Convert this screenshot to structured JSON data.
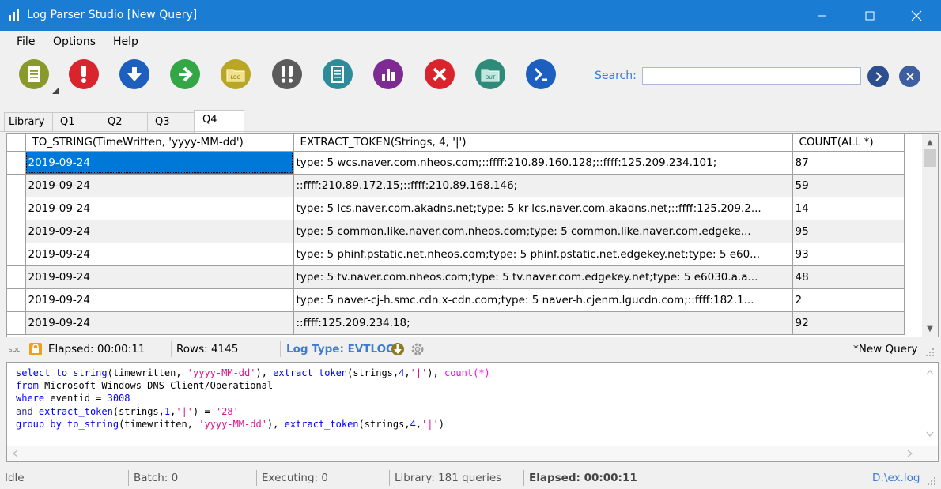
{
  "window": {
    "title": "Log Parser Studio  [New Query]"
  },
  "menu": [
    "File",
    "Options",
    "Help"
  ],
  "toolbar": {
    "buttons": [
      {
        "name": "new-query-icon",
        "color": "#8a9a2a"
      },
      {
        "name": "alert-icon",
        "color": "#d9232d"
      },
      {
        "name": "download-icon",
        "color": "#1d5fbf"
      },
      {
        "name": "arrow-right-icon",
        "color": "#33a745"
      },
      {
        "name": "log-folder-icon",
        "color": "#b9a623"
      },
      {
        "name": "double-alert-icon",
        "color": "#5b5b5b"
      },
      {
        "name": "document-icon",
        "color": "#2e8b9a"
      },
      {
        "name": "chart-icon",
        "color": "#7d2b92"
      },
      {
        "name": "cancel-icon",
        "color": "#d9232d"
      },
      {
        "name": "out-folder-icon",
        "color": "#2e8b7a"
      },
      {
        "name": "powershell-icon",
        "color": "#1d5fbf"
      }
    ],
    "search_label": "Search:",
    "search_value": ""
  },
  "tabs": [
    "Library",
    "Q1",
    "Q2",
    "Q3",
    "Q4"
  ],
  "grid": {
    "columns": [
      "TO_STRING(TimeWritten, 'yyyy-MM-dd')",
      "EXTRACT_TOKEN(Strings, 4, '|')",
      "COUNT(ALL *)"
    ],
    "rows": [
      [
        "2019-09-24",
        "type:  5 wcs.naver.com.nheos.com;::ffff:210.89.160.128;::ffff:125.209.234.101;",
        "87"
      ],
      [
        "2019-09-24",
        "::ffff:210.89.172.15;::ffff:210.89.168.146;",
        "59"
      ],
      [
        "2019-09-24",
        "type:  5 lcs.naver.com.akadns.net;type:  5 kr-lcs.naver.com.akadns.net;::ffff:125.209.2...",
        "14"
      ],
      [
        "2019-09-24",
        "type:  5 common.like.naver.com.nheos.com;type:  5 common.like.naver.com.edgeke...",
        "95"
      ],
      [
        "2019-09-24",
        "type:  5 phinf.pstatic.net.nheos.com;type:  5 phinf.pstatic.net.edgekey.net;type:  5 e60...",
        "93"
      ],
      [
        "2019-09-24",
        "type:  5 tv.naver.com.nheos.com;type:  5 tv.naver.com.edgekey.net;type:  5 e6030.a.a...",
        "48"
      ],
      [
        "2019-09-24",
        "type:  5 naver-cj-h.smc.cdn.x-cdn.com;type:  5 naver-h.cjenm.lgucdn.com;::ffff:182.1...",
        "2"
      ],
      [
        "2019-09-24",
        "::ffff:125.209.234.18;",
        "92"
      ]
    ]
  },
  "query_status": {
    "elapsed": "Elapsed: 00:00:11",
    "rows": "Rows: 4145",
    "log_type": "Log Type: EVTLOG",
    "modified": "*New Query"
  },
  "query": {
    "lines": [
      "select to_string(timewritten, 'yyyy-MM-dd'), extract_token(strings,4,'|'), count(*)",
      "from Microsoft-Windows-DNS-Client/Operational",
      "where eventid = 3008",
      "and extract_token(strings,1,'|') = '28'",
      "group by to_string(timewritten, 'yyyy-MM-dd'), extract_token(strings,4,'|')"
    ]
  },
  "statusbar": {
    "state": "Idle",
    "batch": "Batch: 0",
    "executing": "Executing: 0",
    "library": "Library: 181 queries",
    "elapsed": "Elapsed: 00:00:11",
    "file": "D:\\ex.log"
  }
}
